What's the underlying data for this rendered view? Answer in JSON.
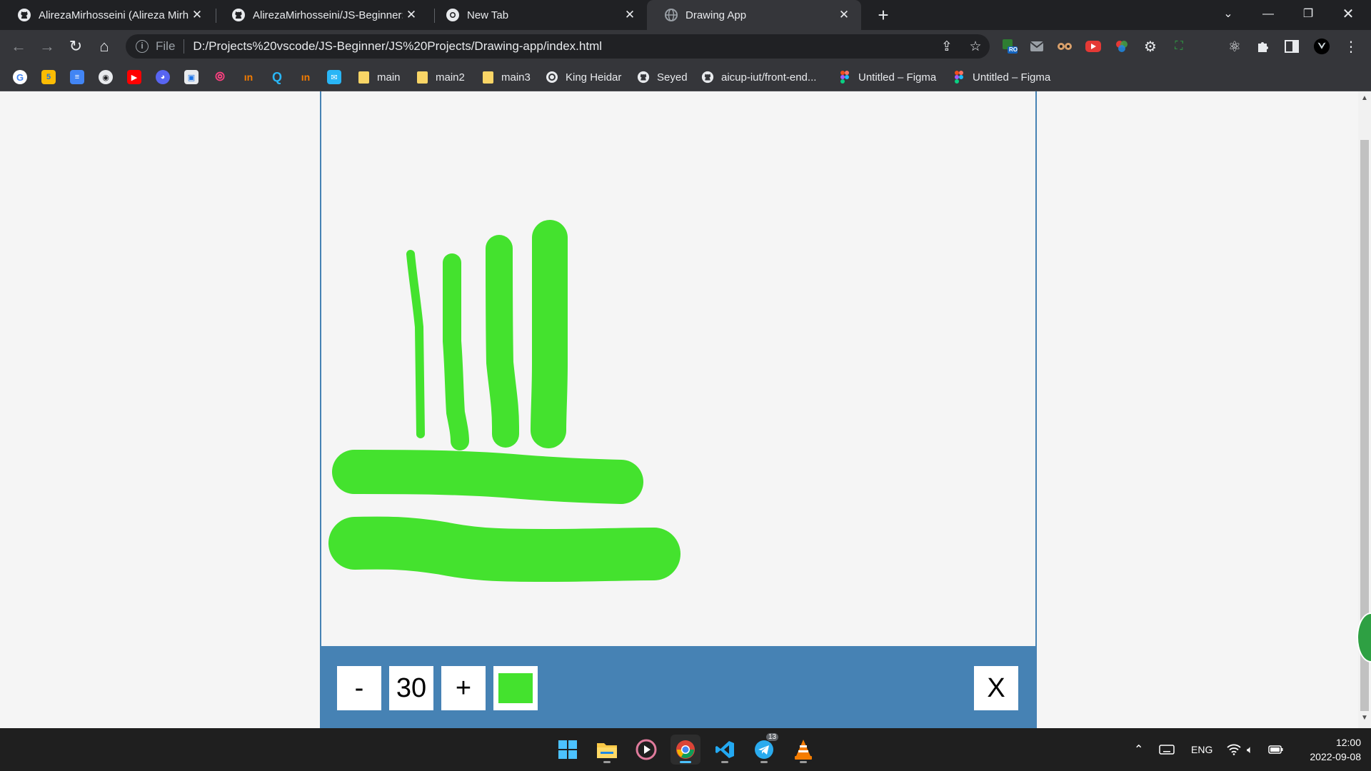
{
  "browser": {
    "tabs": [
      {
        "title": "AlirezaMirhosseini (Alireza Mirho",
        "icon": "github-icon",
        "active": false
      },
      {
        "title": "AlirezaMirhosseini/JS-Beginner: s",
        "icon": "github-icon",
        "active": false
      },
      {
        "title": "New Tab",
        "icon": "chrome-icon",
        "active": false
      },
      {
        "title": "Drawing App",
        "icon": "globe-icon",
        "active": true
      }
    ],
    "address": {
      "scheme_label": "File",
      "url": "D:/Projects%20vscode/JS-Beginner/JS%20Projects/Drawing-app/index.html"
    },
    "bookmarks": [
      {
        "label": "main",
        "icon": "folder-icon"
      },
      {
        "label": "main2",
        "icon": "folder-icon"
      },
      {
        "label": "main3",
        "icon": "folder-icon"
      },
      {
        "label": "King Heidar",
        "icon": "site-icon"
      },
      {
        "label": "Seyed",
        "icon": "github-icon"
      },
      {
        "label": "aicup-iut/front-end...",
        "icon": "github-icon"
      },
      {
        "label": "Untitled – Figma",
        "icon": "figma-icon"
      },
      {
        "label": "Untitled – Figma",
        "icon": "figma-icon"
      }
    ],
    "extension_badge": "RO"
  },
  "app": {
    "canvas": {
      "stroke_color": "#44e22e",
      "strokes": [
        {
          "id": "stroke-1",
          "type": "vertical"
        },
        {
          "id": "stroke-2",
          "type": "vertical"
        },
        {
          "id": "stroke-3",
          "type": "vertical"
        },
        {
          "id": "stroke-4",
          "type": "vertical"
        },
        {
          "id": "stroke-5",
          "type": "horizontal"
        },
        {
          "id": "stroke-6",
          "type": "horizontal"
        }
      ]
    },
    "toolbox": {
      "decrease_label": "-",
      "size_value": "30",
      "increase_label": "+",
      "color_value": "#44e22e",
      "clear_label": "X",
      "background_color": "#4682b4"
    }
  },
  "taskbar": {
    "apps": [
      "windows-start-icon",
      "file-explorer-icon",
      "media-player-icon",
      "chrome-icon",
      "vscode-icon",
      "telegram-icon",
      "vlc-icon"
    ],
    "telegram_badge": "13",
    "language": "ENG",
    "time": "12:00",
    "date": "2022-09-08"
  }
}
